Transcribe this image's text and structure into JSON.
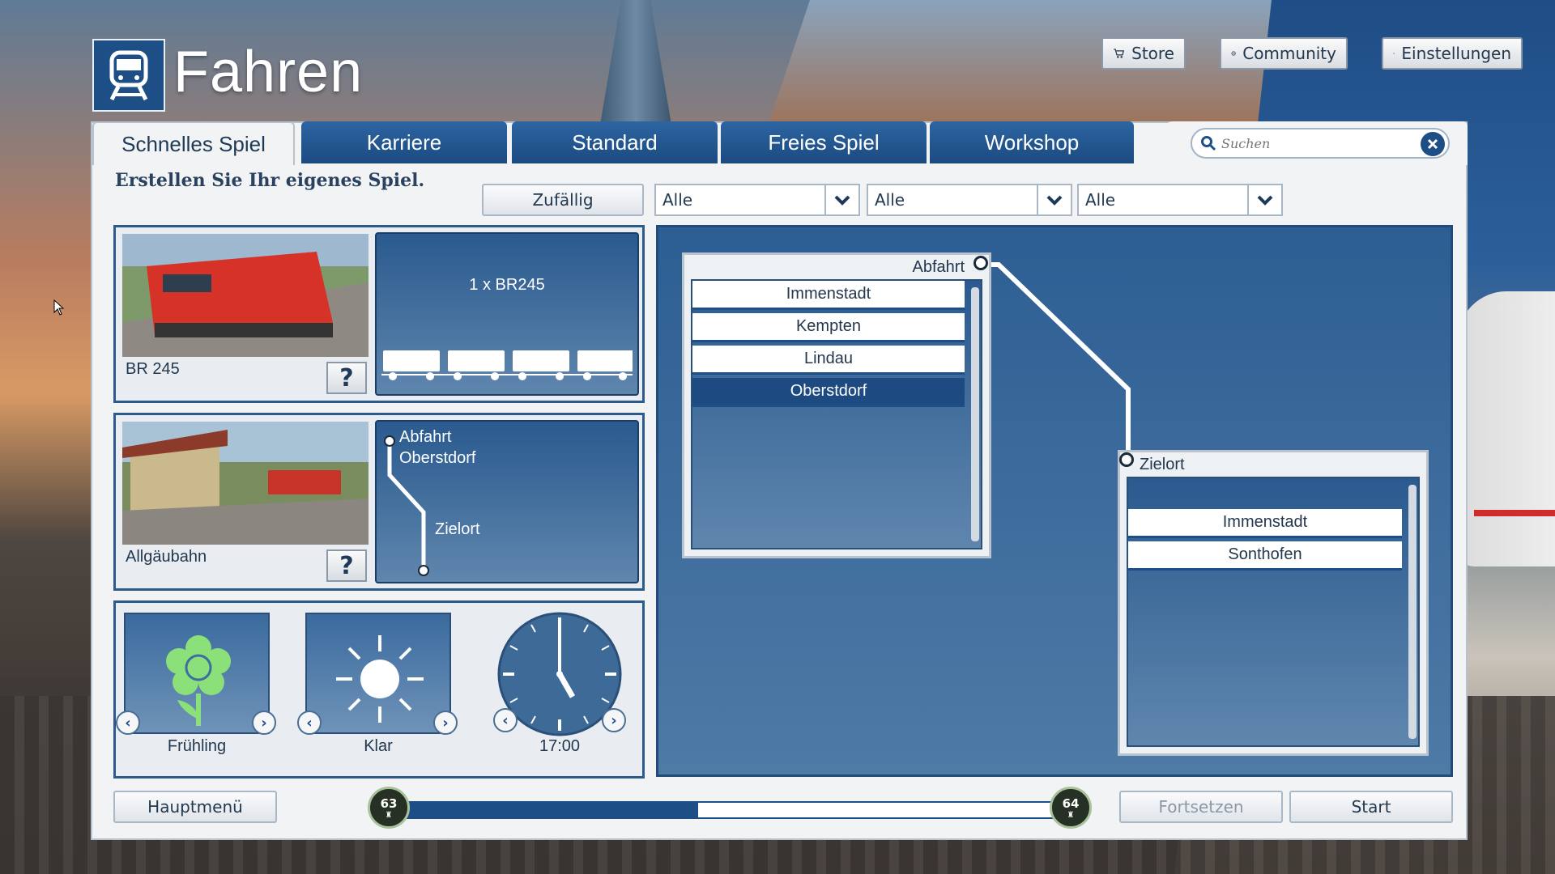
{
  "header": {
    "title": "Fahren",
    "store": "Store",
    "community": "Community",
    "settings": "Einstellungen"
  },
  "tabs": [
    {
      "label": "Schnelles Spiel",
      "active": true
    },
    {
      "label": "Karriere"
    },
    {
      "label": "Standard"
    },
    {
      "label": "Freies Spiel"
    },
    {
      "label": "Workshop"
    }
  ],
  "search": {
    "placeholder": "Suchen"
  },
  "subtitle": "Erstellen Sie Ihr eigenes Spiel.",
  "filters": {
    "random_label": "Zufällig",
    "selects": [
      "Alle",
      "Alle",
      "Alle"
    ]
  },
  "loco": {
    "name": "BR 245",
    "consist": "1 x BR245",
    "wagon_count": 4
  },
  "route": {
    "name": "Allgäubahn",
    "start_label": "Abfahrt",
    "start_station": "Oberstdorf",
    "end_label": "Zielort"
  },
  "environment": {
    "season": "Frühling",
    "weather": "Klar",
    "time": "17:00"
  },
  "departure": {
    "label": "Abfahrt",
    "items": [
      "Immenstadt",
      "Kempten",
      "Lindau",
      "Oberstdorf"
    ],
    "selected": "Oberstdorf"
  },
  "destination": {
    "label": "Zielort",
    "items": [
      "Immenstadt",
      "Sonthofen"
    ]
  },
  "footer": {
    "main_menu": "Hauptmenü",
    "continue": "Fortsetzen",
    "start": "Start"
  },
  "progress": {
    "level_current": "63",
    "level_next": "64",
    "fraction": 0.44
  },
  "colors": {
    "accent": "#1d4f86",
    "tab": "#1f5592",
    "leaf_green": "#8be07a"
  }
}
